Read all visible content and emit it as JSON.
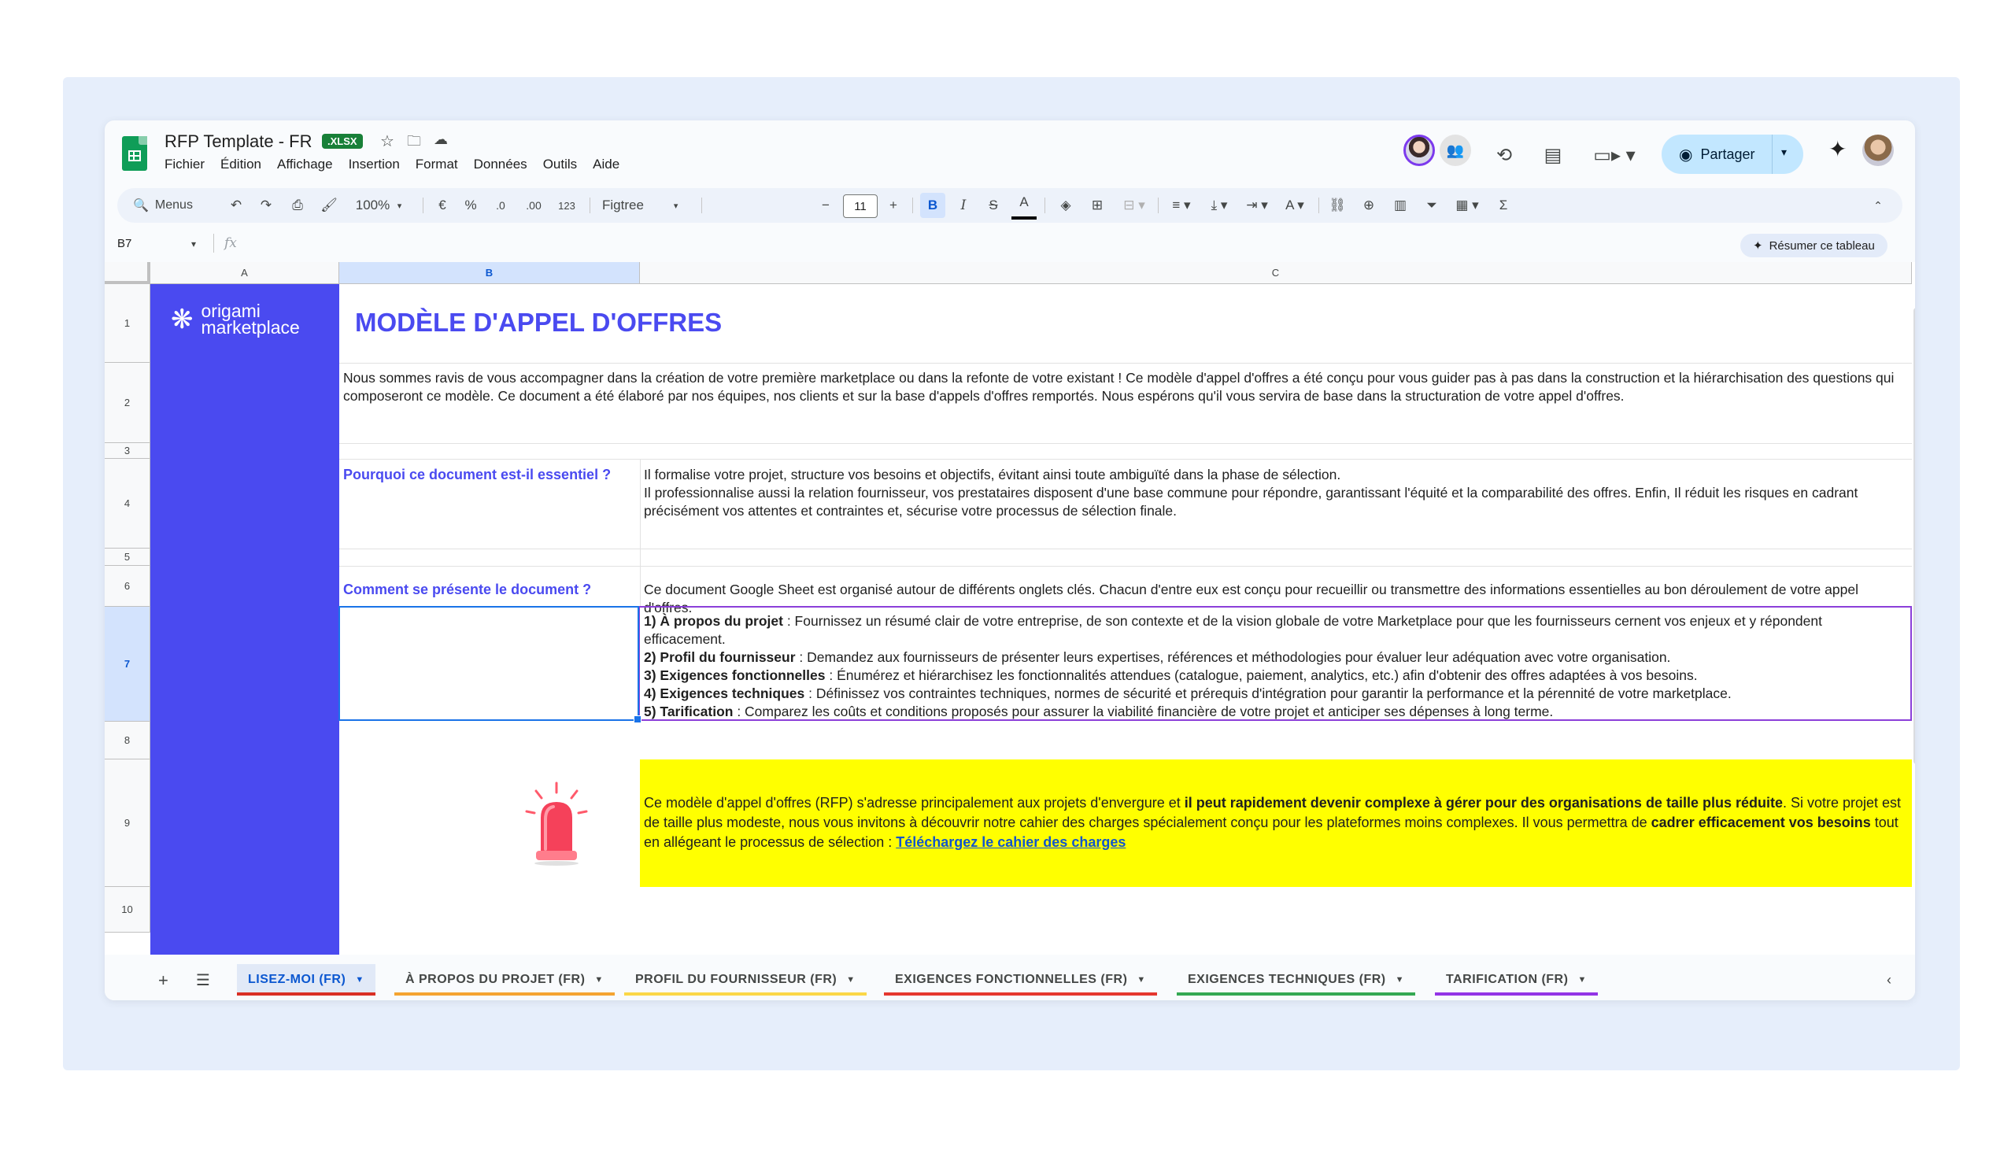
{
  "app": {
    "doc_title": "RFP Template - FR",
    "badge": ".XLSX",
    "menu": [
      "Fichier",
      "Édition",
      "Affichage",
      "Insertion",
      "Format",
      "Données",
      "Outils",
      "Aide"
    ],
    "share_label": "Partager"
  },
  "toolbar": {
    "search_label": "Menus",
    "zoom": "100%",
    "currency": "€",
    "percent": "%",
    "dec_less": ".0",
    "dec_more": ".00",
    "number_format": "123",
    "font": "Figtree",
    "font_size": "11",
    "bold": "B",
    "italic": "I",
    "strike": "S",
    "text_color": "A",
    "sigma": "Σ"
  },
  "formula_bar": {
    "cell_ref": "B7",
    "fx": "fx",
    "summarize_label": "Résumer ce tableau"
  },
  "grid": {
    "columns": [
      "A",
      "B",
      "C"
    ],
    "rows": [
      "1",
      "2",
      "3",
      "4",
      "5",
      "6",
      "7",
      "8",
      "9",
      "10"
    ],
    "brand_line1": "origami",
    "brand_line2": "marketplace",
    "title": "MODÈLE D'APPEL D'OFFRES",
    "intro": "Nous sommes ravis de vous accompagner dans la création de votre première marketplace ou dans la refonte de votre existant ! Ce modèle d'appel d'offres a été conçu pour vous guider pas à pas dans la construction et la hiérarchisation des questions qui composeront ce modèle. Ce document a été élaboré par nos équipes, nos clients et sur la base d'appels d'offres remportés. Nous espérons qu'il vous servira de base dans la structuration de votre appel d'offres.",
    "q1_label": "Pourquoi ce document est-il essentiel ?",
    "q1_line1": "Il formalise votre projet, structure vos besoins et objectifs, évitant ainsi toute ambiguïté dans la phase de sélection.",
    "q1_line2": "Il professionnalise aussi la relation fournisseur, vos prestataires disposent d'une base commune pour répondre, garantissant l'équité et la comparabilité des offres. Enfin, Il réduit les risques en cadrant précisément vos attentes et contraintes et, sécurise votre processus de sélection finale.",
    "q2_label": "Comment se présente le document ?",
    "q2_text": "Ce document Google Sheet est organisé autour de différents onglets clés. Chacun d'entre eux est conçu pour recueillir ou transmettre des informations essentielles au bon déroulement de votre appel d'offres.",
    "items": [
      {
        "bold": "1) À propos du projet",
        "text": " : Fournissez un résumé clair de votre entreprise, de son contexte et de la vision globale de votre Marketplace pour que les fournisseurs cernent vos enjeux et y répondent efficacement."
      },
      {
        "bold": "2) Profil du fournisseur",
        "text": " : Demandez aux fournisseurs de présenter leurs expertises, références et méthodologies pour évaluer leur adéquation avec votre organisation."
      },
      {
        "bold": "3) Exigences fonctionnelles",
        "text": " : Énumérez et hiérarchisez les fonctionnalités attendues (catalogue, paiement, analytics, etc.) afin d'obtenir des offres adaptées à vos besoins."
      },
      {
        "bold": "4) Exigences techniques",
        "text": " : Définissez vos contraintes techniques, normes de sécurité et prérequis d'intégration pour garantir la performance et la pérennité de votre marketplace."
      },
      {
        "bold": "5) Tarification",
        "text": " : Comparez les coûts et conditions proposés pour assurer la viabilité financière de votre projet et anticiper ses dépenses à long terme."
      }
    ],
    "note_part1": "Ce modèle d'appel d'offres (RFP) s'adresse principalement aux projets d'envergure et ",
    "note_bold1": "il peut rapidement devenir complexe à gérer pour des organisations de taille plus réduite",
    "note_part2": ". Si votre projet est de taille plus modeste, nous vous invitons à découvrir notre cahier des charges spécialement conçu pour les plateformes moins complexes. Il vous permettra de ",
    "note_bold2": "cadrer efficacement vos besoins",
    "note_part3": " tout en allégeant le processus de sélection : ",
    "note_link": "Téléchargez le cahier des charges"
  },
  "tabs": [
    {
      "label": "LISEZ-MOI (FR)",
      "color": "#d93025"
    },
    {
      "label": "À PROPOS DU PROJET (FR)",
      "color": "#f4a431"
    },
    {
      "label": "PROFIL DU FOURNISSEUR (FR)",
      "color": "#fbd747"
    },
    {
      "label": "EXIGENCES FONCTIONNELLES (FR)",
      "color": "#e5372f"
    },
    {
      "label": "EXIGENCES TECHNIQUES (FR)",
      "color": "#34a853"
    },
    {
      "label": "TARIFICATION (FR)",
      "color": "#9334e6"
    }
  ],
  "colors": {
    "brand_blue": "#4a4af0",
    "highlight_yellow": "#ffff00",
    "selection_blue": "#1a73e8",
    "purple_border": "#8b3fd9"
  }
}
